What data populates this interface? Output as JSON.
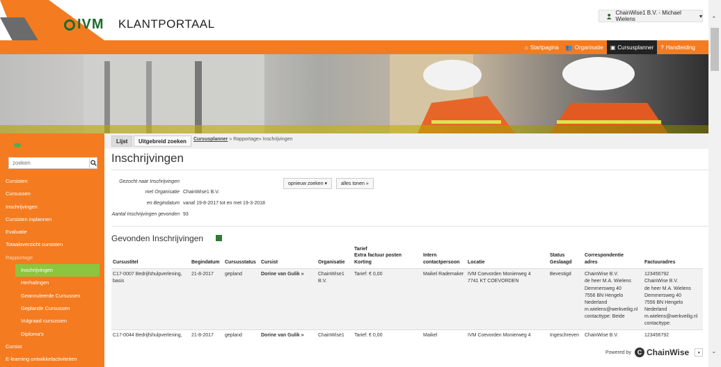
{
  "header": {
    "logo_text": "IVM",
    "portal_title": "KLANTPORTAAL",
    "user_menu": "ChainWise1 B.V. - Michael Wielens"
  },
  "nav": {
    "items": [
      {
        "label": "Startpagina",
        "icon": "home-icon"
      },
      {
        "label": "Organisatie",
        "icon": "users-icon"
      },
      {
        "label": "Cursusplanner",
        "icon": "calendar-icon",
        "active": true
      },
      {
        "label": "Handleiding",
        "icon": "help-icon"
      }
    ]
  },
  "sidebar": {
    "search_placeholder": "zoeken",
    "items": [
      {
        "label": "Cursisten"
      },
      {
        "label": "Cursussen"
      },
      {
        "label": "Inschrijvingen"
      },
      {
        "label": "Cursisten inplannen"
      },
      {
        "label": "Evaluatie"
      },
      {
        "label": "Totaaloverzicht cursisten"
      },
      {
        "label": "Rapportage"
      },
      {
        "label": "Inschrijvingen"
      },
      {
        "label": "Herhalingen"
      },
      {
        "label": "Geannuleerde Cursussen"
      },
      {
        "label": "Geplande Cursussen"
      },
      {
        "label": "Vulgraad cursussen"
      },
      {
        "label": "Diploma's"
      },
      {
        "label": "Cursist"
      },
      {
        "label": "E-learning ontwikkelactiviteiten"
      }
    ]
  },
  "content": {
    "tabs": {
      "list": "Lijst",
      "advanced": "Uitgebreid zoeken"
    },
    "breadcrumb": {
      "link": "Cursusplanner",
      "rest": " » Rapportage» Inschrijvingen"
    },
    "page_title": "Inschrijvingen",
    "criteria": [
      {
        "label": "Gezocht naar Inschrijvingen",
        "value": ""
      },
      {
        "label": "met Organisatie",
        "value": "ChainWise1 B.V."
      },
      {
        "label": "en Begindatum",
        "value": "vanaf 19-8-2017 tot en met 19-3-2018"
      },
      {
        "label": "Aantal Inschrijvingen gevonden",
        "value": "93"
      }
    ],
    "buttons": {
      "research": "opnieuw zoeken ▾",
      "show_all": "alles tonen »"
    },
    "results_title": "Gevonden Inschrijvingen",
    "table": {
      "headers": {
        "c1": "Cursustitel",
        "c2": "Begindatum",
        "c3": "Cursusstatus",
        "c4": "Cursist",
        "c5": "Organisatie",
        "c6a": "Tarief",
        "c6b": "Extra factuur posten",
        "c6c": "Korting",
        "c7a": "Intern",
        "c7b": "contactpersoon",
        "c8": "Locatie",
        "c9a": "Status",
        "c9b": "Geslaagd",
        "c10a": "Correspondentie",
        "c10b": "adres",
        "c11": "Factuuradres"
      },
      "rows": [
        {
          "title": "C17-0007 Bedrijfshulpverlening, basis",
          "date": "21-8-2017",
          "status": "gepland",
          "student": "Dorine van Gulik »",
          "org": "ChainWise1 B.V.",
          "tarief": "Tarief: € 0,00",
          "contact": "Maikel Rademaker",
          "location_l1": "IVM Coevorden Monierweg 4",
          "location_l2": "7741 KT COEVORDEN",
          "state": "Bevestigd",
          "corr": [
            "ChainWise B.V.",
            "de heer M.A. Wielens",
            "Demmersweg 40",
            "7556 BN Hengelo",
            "Nederland",
            "m.wielens@werkveilig.nl",
            "contacttype: Beide"
          ],
          "inv": [
            "123456792",
            "ChainWise B.V.",
            "de heer M.A. Wielens",
            "Demmersweg 40",
            "7556 BN Hengelo",
            "Nederland",
            "m.wielens@werkveilig.nl",
            "contacttype:"
          ]
        },
        {
          "title": "C17-0044 Bedrijfshulpverlening,",
          "date": "21-8-2017",
          "status": "gepland",
          "student": "Dorine van Gulik »",
          "org": "ChainWise1",
          "tarief": "Tarief: € 0,00",
          "contact": "Maikel",
          "location_l1": "IVM Coevorden Monierweg 4",
          "state": "Ingeschreven",
          "corr1": "ChainWise B.V.",
          "inv1": "123456792"
        }
      ]
    }
  },
  "footer": {
    "powered": "Powered by",
    "brand": "ChainWise"
  },
  "colors": {
    "accent": "#f47b20",
    "logo_green": "#1c6b2c",
    "active_green": "#8cc63f"
  }
}
